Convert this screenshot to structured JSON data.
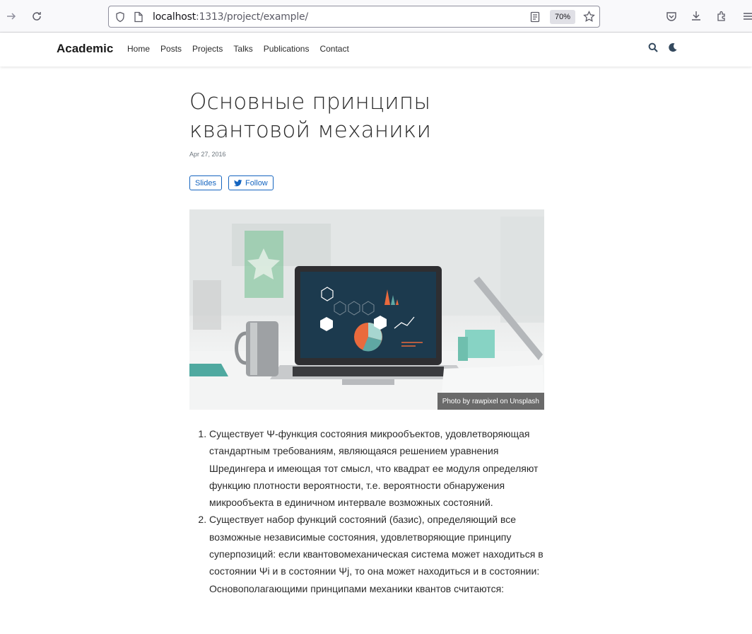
{
  "browser": {
    "url_host": "localhost",
    "url_rest": ":1313/project/example/",
    "zoom": "70%"
  },
  "site": {
    "brand": "Academic",
    "nav": [
      "Home",
      "Posts",
      "Projects",
      "Talks",
      "Publications",
      "Contact"
    ]
  },
  "article": {
    "title": "Основные принципы квантовой механики",
    "date": "Apr 27, 2016",
    "buttons": {
      "slides": "Slides",
      "follow": "Follow"
    },
    "image_caption": "Photo by rawpixel on Unsplash",
    "list": [
      "Существует Ψ-функция состояния микрообъектов, удовлетворяющая стандартным требованиям, являющаяся решением уравнения Шредингера и имеющая тот смысл, что квадрат ее модуля определяют функцию плотности вероятности, т.е. вероятности обнаружения микрообъекта в единичном интервале возможных состояний.",
      "Существует набор функций состояний (базис), определяющий все возможные независимые состояния, удовлетворяющие принципу суперпозиций: если квантовомеханическая система может находиться в состоянии Ψi и в состоянии Ψj, то она может находиться и в состоянии: Основополагающими принципами механики квантов считаются:"
    ]
  },
  "colors": {
    "accent": "#1565c0",
    "text": "#2b2b2b"
  }
}
